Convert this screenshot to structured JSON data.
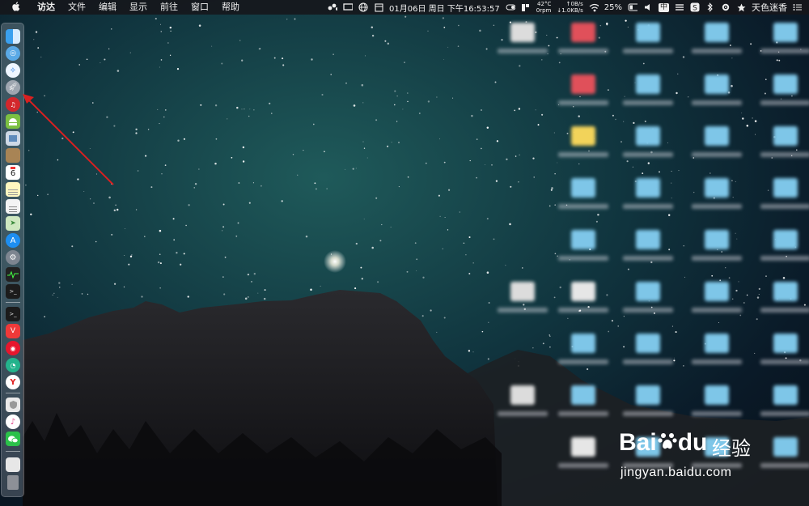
{
  "menubar": {
    "app_name": "访达",
    "items": [
      "文件",
      "编辑",
      "显示",
      "前往",
      "窗口",
      "帮助"
    ],
    "clock": "01月06日 周日 下午16:53:57",
    "temperature": "42°C",
    "rpm": "0rpm",
    "net_up": "0B/s",
    "net_down": "1.0KB/s",
    "battery": "25%",
    "ime": "中",
    "user": "天色迷香"
  },
  "dock": {
    "items": [
      "finder",
      "network-utility",
      "safari",
      "launchpad",
      "netease-music",
      "android-file-transfer",
      "preview",
      "notefile",
      "calendar",
      "notes",
      "textedit",
      "maps",
      "app-store",
      "system-preferences",
      "activity-monitor",
      "terminal",
      "vivaldi",
      "weibo",
      "sogou-browser",
      "yandex",
      "shield-app",
      "itunes",
      "wechat",
      "documents-stack",
      "trash"
    ],
    "calendar_day": "6"
  },
  "watermark": {
    "brand": "Bai",
    "brand_tail": "du",
    "cn": "经验",
    "url": "jingyan.baidu.com"
  }
}
